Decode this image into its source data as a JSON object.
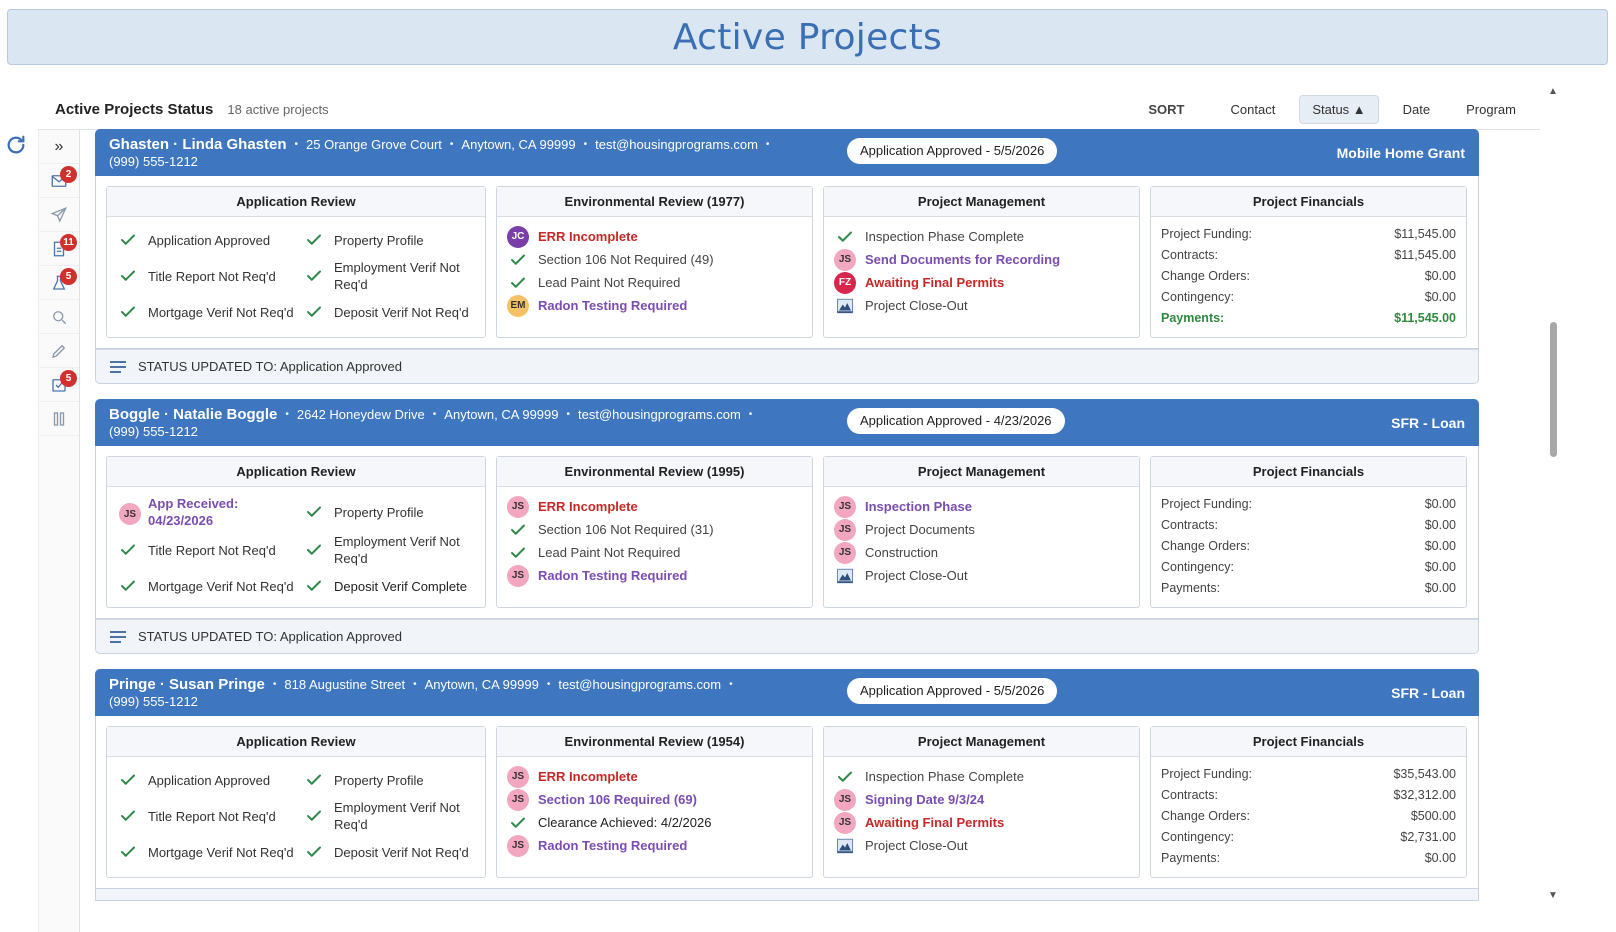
{
  "page_title": "Active Projects",
  "header": {
    "title": "Active Projects Status",
    "count": "18 active projects",
    "sort_label": "SORT",
    "sort_options": [
      "Contact",
      "Status ▲",
      "Date",
      "Program"
    ],
    "active_sort": "Status"
  },
  "rail": {
    "expand": "»",
    "items": [
      {
        "icon": "mail-icon",
        "badge": "2"
      },
      {
        "icon": "send-icon",
        "badge": ""
      },
      {
        "icon": "document-icon",
        "badge": "11"
      },
      {
        "icon": "flask-icon",
        "badge": "5"
      },
      {
        "icon": "search-icon",
        "badge": ""
      },
      {
        "icon": "pencil-icon",
        "badge": ""
      },
      {
        "icon": "checklist-icon",
        "badge": "5"
      },
      {
        "icon": "columns-icon",
        "badge": ""
      }
    ]
  },
  "projects": [
    {
      "name": "Ghasten · Linda Ghasten",
      "address": "25 Orange Grove Court",
      "city": "Anytown, CA 99999",
      "email": "test@housingprograms.com",
      "phone": "(999) 555-1212",
      "status": "Application Approved - 5/5/2026",
      "program": "Mobile Home Grant",
      "app_review_title": "Application Review",
      "app_review": [
        {
          "label": "Application Approved",
          "icon": "check"
        },
        {
          "label": "Property Profile",
          "icon": "check"
        },
        {
          "label": "Title Report Not Req'd",
          "icon": "check"
        },
        {
          "label": "Employment Verif Not Req'd",
          "icon": "check"
        },
        {
          "label": "Mortgage Verif Not Req'd",
          "icon": "check"
        },
        {
          "label": "Deposit Verif Not Req'd",
          "icon": "check"
        }
      ],
      "env_title": "Environmental Review (1977)",
      "env": [
        {
          "label": "ERR Incomplete",
          "avatar": "JC",
          "style": "red"
        },
        {
          "label": "Section 106 Not Required (49)",
          "icon": "check"
        },
        {
          "label": "Lead Paint Not Required",
          "icon": "check"
        },
        {
          "label": "Radon Testing Required",
          "avatar": "EM",
          "style": "purple"
        }
      ],
      "pm_title": "Project Management",
      "pm": [
        {
          "label": "Inspection Phase Complete",
          "icon": "check"
        },
        {
          "label": "Send Documents for Recording",
          "avatar": "JS",
          "style": "purple"
        },
        {
          "label": "Awaiting Final Permits",
          "avatar": "FZ",
          "style": "red"
        },
        {
          "label": "Project Close-Out",
          "icon": "closeout"
        }
      ],
      "fin_title": "Project Financials",
      "financials": [
        {
          "label": "Project Funding:",
          "value": "$11,545.00"
        },
        {
          "label": "Contracts:",
          "value": "$11,545.00"
        },
        {
          "label": "Change Orders:",
          "value": "$0.00"
        },
        {
          "label": "Contingency:",
          "value": "$0.00"
        },
        {
          "label": "Payments:",
          "value": "$11,545.00",
          "green": true
        }
      ],
      "status_update": "STATUS UPDATED TO: Application Approved"
    },
    {
      "name": "Boggle · Natalie Boggle",
      "address": "2642 Honeydew Drive",
      "city": "Anytown, CA 99999",
      "email": "test@housingprograms.com",
      "phone": "(999) 555-1212",
      "status": "Application Approved - 4/23/2026",
      "program": "SFR - Loan",
      "app_review_title": "Application Review",
      "app_review": [
        {
          "label": "App Received: 04/23/2026",
          "avatar": "JS",
          "style": "purple"
        },
        {
          "label": "Property Profile",
          "icon": "check"
        },
        {
          "label": "Title Report Not Req'd",
          "icon": "check"
        },
        {
          "label": "Employment Verif Not Req'd",
          "icon": "check"
        },
        {
          "label": "Mortgage Verif Not Req'd",
          "icon": "check"
        },
        {
          "label": "Deposit Verif Complete",
          "icon": "check",
          "style": "dark"
        }
      ],
      "env_title": "Environmental Review (1995)",
      "env": [
        {
          "label": "ERR Incomplete",
          "avatar": "JS",
          "style": "red"
        },
        {
          "label": "Section 106 Not Required (31)",
          "icon": "check"
        },
        {
          "label": "Lead Paint Not Required",
          "icon": "check"
        },
        {
          "label": "Radon Testing Required",
          "avatar": "JS",
          "style": "purple"
        }
      ],
      "pm_title": "Project Management",
      "pm": [
        {
          "label": "Inspection Phase",
          "avatar": "JS",
          "style": "purple"
        },
        {
          "label": "Project Documents",
          "avatar": "JS"
        },
        {
          "label": "Construction",
          "avatar": "JS"
        },
        {
          "label": "Project Close-Out",
          "icon": "closeout"
        }
      ],
      "fin_title": "Project Financials",
      "financials": [
        {
          "label": "Project Funding:",
          "value": "$0.00"
        },
        {
          "label": "Contracts:",
          "value": "$0.00"
        },
        {
          "label": "Change Orders:",
          "value": "$0.00"
        },
        {
          "label": "Contingency:",
          "value": "$0.00"
        },
        {
          "label": "Payments:",
          "value": "$0.00"
        }
      ],
      "status_update": "STATUS UPDATED TO: Application Approved"
    },
    {
      "name": "Pringe · Susan Pringe",
      "address": "818 Augustine Street",
      "city": "Anytown, CA 99999",
      "email": "test@housingprograms.com",
      "phone": "(999) 555-1212",
      "status": "Application Approved - 5/5/2026",
      "program": "SFR - Loan",
      "app_review_title": "Application Review",
      "app_review": [
        {
          "label": "Application Approved",
          "icon": "check"
        },
        {
          "label": "Property Profile",
          "icon": "check"
        },
        {
          "label": "Title Report Not Req'd",
          "icon": "check"
        },
        {
          "label": "Employment Verif Not Req'd",
          "icon": "check"
        },
        {
          "label": "Mortgage Verif Not Req'd",
          "icon": "check"
        },
        {
          "label": "Deposit Verif Not Req'd",
          "icon": "check"
        }
      ],
      "env_title": "Environmental Review (1954)",
      "env": [
        {
          "label": "ERR Incomplete",
          "avatar": "JS",
          "style": "red"
        },
        {
          "label": "Section 106 Required (69)",
          "avatar": "JS",
          "style": "purple"
        },
        {
          "label": "Clearance Achieved: 4/2/2026",
          "icon": "check",
          "style": "dark"
        },
        {
          "label": "Radon Testing Required",
          "avatar": "JS",
          "style": "purple"
        }
      ],
      "pm_title": "Project Management",
      "pm": [
        {
          "label": "Inspection Phase Complete",
          "icon": "check"
        },
        {
          "label": "Signing Date 9/3/24",
          "avatar": "JS",
          "style": "purple"
        },
        {
          "label": "Awaiting Final Permits",
          "avatar": "JS",
          "style": "red"
        },
        {
          "label": "Project Close-Out",
          "icon": "closeout"
        }
      ],
      "fin_title": "Project Financials",
      "financials": [
        {
          "label": "Project Funding:",
          "value": "$35,543.00"
        },
        {
          "label": "Contracts:",
          "value": "$32,312.00"
        },
        {
          "label": "Change Orders:",
          "value": "$500.00"
        },
        {
          "label": "Contingency:",
          "value": "$2,731.00"
        },
        {
          "label": "Payments:",
          "value": "$0.00"
        }
      ],
      "status_update": ""
    }
  ]
}
